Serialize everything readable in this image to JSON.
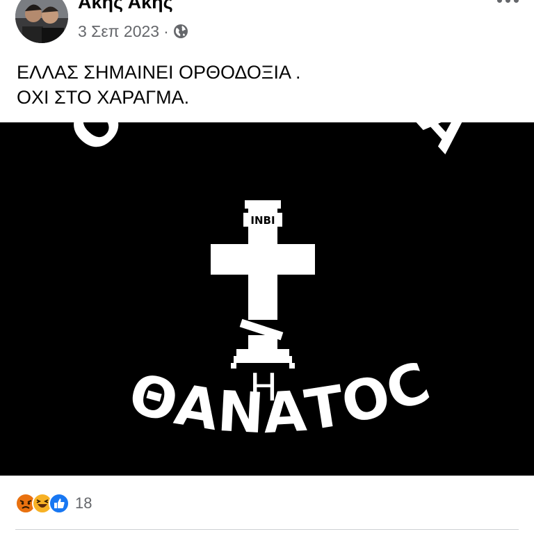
{
  "post": {
    "author": "Ακης Ακης",
    "date": "3 Σεπ 2023",
    "separator": "·",
    "privacy_icon": "globe-icon",
    "text_lines": [
      "ΕΛΛΑΣ ΣΗΜΑΙΝΕΙ ΟΡΘΟΔΟΞΙΑ .",
      "ΟΧΙ ΣΤΟ ΧΑΡΑΓΜΑ."
    ]
  },
  "image": {
    "background": "#000000",
    "foreground": "#ffffff",
    "top_text": "ΟΡΘΟΔΟΞΙΑ",
    "cross_label": "INBI",
    "middle_text": "Η",
    "bottom_text": "ΘΑΝΑΤΟC"
  },
  "reactions": {
    "icons": [
      "angry-icon",
      "haha-icon",
      "like-icon"
    ],
    "count": "18"
  }
}
